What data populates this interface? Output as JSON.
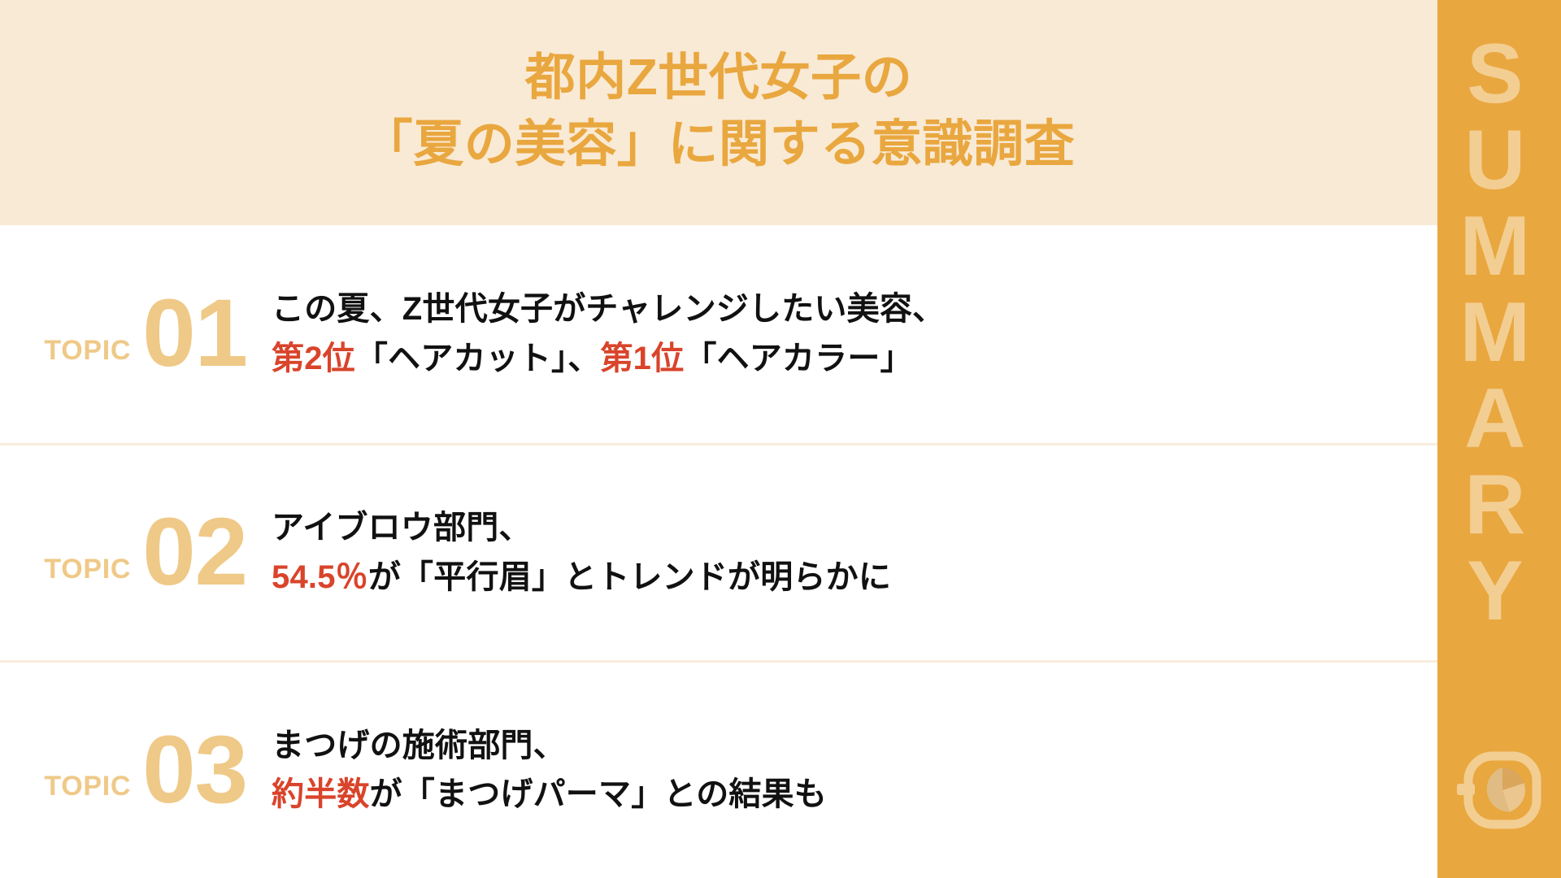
{
  "slide": {
    "kind": "summary-slide",
    "colors": {
      "header_bg": "#F9EAD5",
      "accent_orange": "#E9A73F",
      "accent_light": "#EFC987",
      "highlight_red": "#D9442B",
      "body_text": "#111111",
      "divider": "#FAEDDD",
      "sidebar_label": "#F3CE92"
    }
  },
  "header": {
    "title_line1": "都内Z世代女子の",
    "title_line2": "「夏の美容」に関する意識調査"
  },
  "sidebar": {
    "label": "SUMMARY",
    "logo_name": "brand-logo-mark"
  },
  "topics": [
    {
      "word": "TOPIC",
      "number": "01",
      "line1": "この夏、Z世代女子がチャレンジしたい美容、",
      "line2_parts": [
        {
          "text": "第2位",
          "highlight": true
        },
        {
          "text": "「ヘアカット」、",
          "highlight": false
        },
        {
          "text": "第1位",
          "highlight": true
        },
        {
          "text": "「ヘアカラー」",
          "highlight": false
        }
      ]
    },
    {
      "word": "TOPIC",
      "number": "02",
      "line1": "アイブロウ部門、",
      "line2_parts": [
        {
          "text": "54.5％",
          "highlight": true
        },
        {
          "text": "が「平行眉」とトレンドが明らかに",
          "highlight": false
        }
      ]
    },
    {
      "word": "TOPIC",
      "number": "03",
      "line1": "まつげの施術部門、",
      "line2_parts": [
        {
          "text": "約半数",
          "highlight": true
        },
        {
          "text": "が「まつげパーマ」との結果も",
          "highlight": false
        }
      ]
    }
  ]
}
